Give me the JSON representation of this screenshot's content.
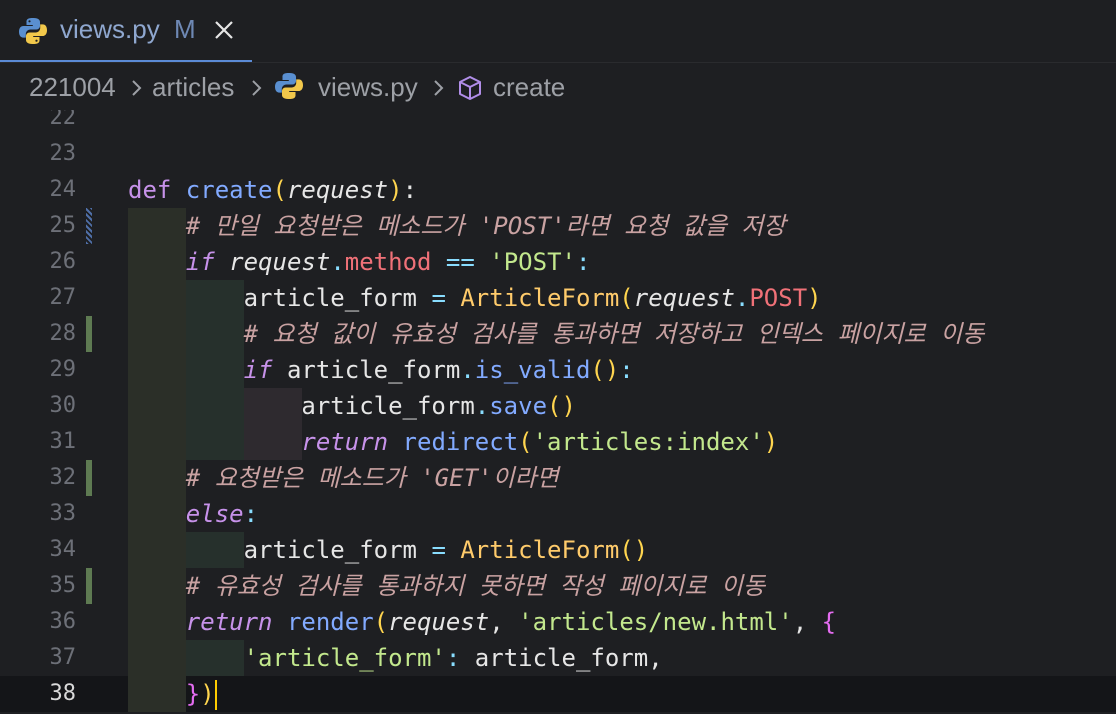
{
  "tab": {
    "filename": "views.py",
    "status": "M"
  },
  "breadcrumb": [
    "221004",
    "articles",
    "views.py",
    "create"
  ],
  "colors": {
    "accent": "#5b8bd6",
    "gutter_modified": "#5e7a52",
    "keyword": "#c792ea",
    "function": "#82aaff",
    "string": "#c3e88d",
    "class": "#ffcb6b",
    "comment": "#c9a2a2"
  },
  "lines": [
    {
      "n": "22",
      "tokens": []
    },
    {
      "n": "23",
      "tokens": []
    },
    {
      "n": "24",
      "tokens": [
        [
          "kwn",
          "def "
        ],
        [
          "fn",
          "create"
        ],
        [
          "par",
          "("
        ],
        [
          "itv",
          "request"
        ],
        [
          "par",
          ")"
        ],
        [
          "var",
          ":"
        ]
      ]
    },
    {
      "n": "25",
      "tokens": [
        [
          "var",
          "    "
        ],
        [
          "cm",
          "# 만일 요청받은 메소드가 'POST'라면 요청 값을 저장"
        ]
      ]
    },
    {
      "n": "26",
      "tokens": [
        [
          "var",
          "    "
        ],
        [
          "kw",
          "if "
        ],
        [
          "itv",
          "request"
        ],
        [
          "op",
          "."
        ],
        [
          "attr",
          "method"
        ],
        [
          "op",
          " == "
        ],
        [
          "str",
          "'POST'"
        ],
        [
          "op",
          ":"
        ]
      ]
    },
    {
      "n": "27",
      "tokens": [
        [
          "var",
          "        article_form "
        ],
        [
          "op",
          "= "
        ],
        [
          "cls",
          "ArticleForm"
        ],
        [
          "par",
          "("
        ],
        [
          "itv",
          "request"
        ],
        [
          "op",
          "."
        ],
        [
          "attr",
          "POST"
        ],
        [
          "par",
          ")"
        ]
      ]
    },
    {
      "n": "28",
      "tokens": [
        [
          "var",
          "        "
        ],
        [
          "cm",
          "# 요청 값이 유효성 검사를 통과하면 저장하고 인덱스 페이지로 이동"
        ]
      ]
    },
    {
      "n": "29",
      "tokens": [
        [
          "var",
          "        "
        ],
        [
          "kw",
          "if "
        ],
        [
          "var",
          "article_form"
        ],
        [
          "op",
          "."
        ],
        [
          "fn",
          "is_valid"
        ],
        [
          "par",
          "()"
        ],
        [
          "op",
          ":"
        ]
      ]
    },
    {
      "n": "30",
      "tokens": [
        [
          "var",
          "            article_form"
        ],
        [
          "op",
          "."
        ],
        [
          "fn",
          "save"
        ],
        [
          "par",
          "()"
        ]
      ]
    },
    {
      "n": "31",
      "tokens": [
        [
          "var",
          "            "
        ],
        [
          "kw",
          "return "
        ],
        [
          "fn",
          "redirect"
        ],
        [
          "par",
          "("
        ],
        [
          "str",
          "'articles:index'"
        ],
        [
          "par",
          ")"
        ]
      ]
    },
    {
      "n": "32",
      "tokens": [
        [
          "var",
          "    "
        ],
        [
          "cm",
          "# 요청받은 메소드가 'GET'이라면"
        ]
      ]
    },
    {
      "n": "33",
      "tokens": [
        [
          "var",
          "    "
        ],
        [
          "kw",
          "else"
        ],
        [
          "op",
          ":"
        ]
      ]
    },
    {
      "n": "34",
      "tokens": [
        [
          "var",
          "        article_form "
        ],
        [
          "op",
          "= "
        ],
        [
          "cls",
          "ArticleForm"
        ],
        [
          "par",
          "()"
        ]
      ]
    },
    {
      "n": "35",
      "tokens": [
        [
          "var",
          "    "
        ],
        [
          "cm",
          "# 유효성 검사를 통과하지 못하면 작성 페이지로 이동"
        ]
      ]
    },
    {
      "n": "36",
      "tokens": [
        [
          "var",
          "    "
        ],
        [
          "kw",
          "return "
        ],
        [
          "fn",
          "render"
        ],
        [
          "par",
          "("
        ],
        [
          "itv",
          "request"
        ],
        [
          "var",
          ", "
        ],
        [
          "str",
          "'articles/new.html'"
        ],
        [
          "var",
          ", "
        ],
        [
          "brc",
          "{"
        ]
      ]
    },
    {
      "n": "37",
      "tokens": [
        [
          "var",
          "        "
        ],
        [
          "str",
          "'article_form'"
        ],
        [
          "op",
          ": "
        ],
        [
          "var",
          "article_form,"
        ]
      ]
    },
    {
      "n": "38",
      "tokens": [
        [
          "var",
          "    "
        ],
        [
          "brc",
          "}"
        ],
        [
          "par",
          ")"
        ]
      ]
    }
  ]
}
